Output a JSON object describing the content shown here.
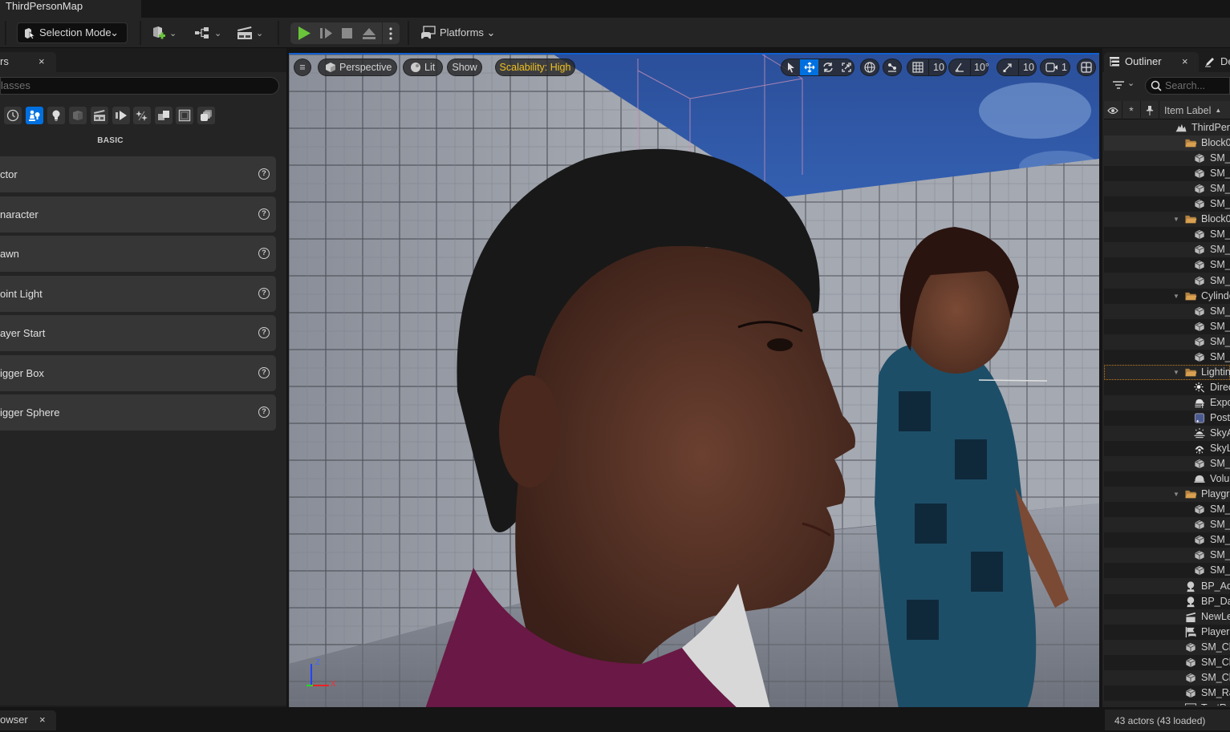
{
  "title_tab": "ThirdPersonMap",
  "toolbar": {
    "selection_mode": "Selection Mode",
    "platforms": "Platforms",
    "icons": [
      "selection-mode-icon",
      "add-actor-icon",
      "blueprint-icon",
      "cinematics-icon",
      "play-icon",
      "step-icon",
      "stop-icon",
      "eject-icon",
      "more-options-icon",
      "platforms-icon"
    ]
  },
  "left_panel": {
    "tab_label": "rs",
    "tab_close": "×",
    "search_placeholder": "lasses",
    "categories": [
      "recent",
      "basic",
      "lights",
      "shapes",
      "cinematic",
      "visual-effects",
      "volumes",
      "all-classes",
      "geometry",
      "others"
    ],
    "active_category": "basic",
    "section_label": "BASIC",
    "items": [
      {
        "label": "ctor"
      },
      {
        "label": "naracter"
      },
      {
        "label": "awn"
      },
      {
        "label": "oint Light"
      },
      {
        "label": "ayer Start"
      },
      {
        "label": "igger Box"
      },
      {
        "label": "igger Sphere"
      }
    ],
    "help_glyph": "?"
  },
  "viewport": {
    "menu_glyph": "≡",
    "perspective": "Perspective",
    "lit": "Lit",
    "show": "Show",
    "scalability": "Scalability: High",
    "grid_snap": "10",
    "rotation_snap": "10°",
    "scale_snap": "10",
    "camera_speed": "1",
    "axis_x": "X",
    "axis_z": "Z",
    "accent": "#0070e0",
    "scalability_color": "#f0c020"
  },
  "outliner": {
    "tab_label": "Outliner",
    "tab_close": "×",
    "details_tab": "De",
    "search_placeholder": "Search...",
    "column_label": "Item Label",
    "sort_glyph": "▲",
    "rows": [
      {
        "label": "ThirdPer",
        "icon": "world",
        "indent": 0,
        "arrow": ""
      },
      {
        "label": "Block0",
        "icon": "folder",
        "indent": 1,
        "arrow": ""
      },
      {
        "label": "SM_",
        "icon": "mesh",
        "indent": 2,
        "arrow": ""
      },
      {
        "label": "SM_",
        "icon": "mesh",
        "indent": 2,
        "arrow": ""
      },
      {
        "label": "SM_",
        "icon": "mesh",
        "indent": 2,
        "arrow": ""
      },
      {
        "label": "SM_",
        "icon": "mesh",
        "indent": 2,
        "arrow": ""
      },
      {
        "label": "Block0",
        "icon": "folder",
        "indent": 1,
        "arrow": "▼"
      },
      {
        "label": "SM_",
        "icon": "mesh",
        "indent": 2,
        "arrow": ""
      },
      {
        "label": "SM_",
        "icon": "mesh",
        "indent": 2,
        "arrow": ""
      },
      {
        "label": "SM_",
        "icon": "mesh",
        "indent": 2,
        "arrow": ""
      },
      {
        "label": "SM_",
        "icon": "mesh",
        "indent": 2,
        "arrow": ""
      },
      {
        "label": "Cylinde",
        "icon": "folder",
        "indent": 1,
        "arrow": "▼"
      },
      {
        "label": "SM_",
        "icon": "mesh",
        "indent": 2,
        "arrow": ""
      },
      {
        "label": "SM_",
        "icon": "mesh",
        "indent": 2,
        "arrow": ""
      },
      {
        "label": "SM_",
        "icon": "mesh",
        "indent": 2,
        "arrow": ""
      },
      {
        "label": "SM_",
        "icon": "mesh",
        "indent": 2,
        "arrow": ""
      },
      {
        "label": "Lightin",
        "icon": "folder",
        "indent": 1,
        "arrow": "▼"
      },
      {
        "label": "Direc",
        "icon": "directional-light",
        "indent": 2,
        "arrow": ""
      },
      {
        "label": "Expo",
        "icon": "exponential-fog",
        "indent": 2,
        "arrow": ""
      },
      {
        "label": "Post",
        "icon": "post-process",
        "indent": 2,
        "arrow": ""
      },
      {
        "label": "SkyA",
        "icon": "sky-atmosphere",
        "indent": 2,
        "arrow": ""
      },
      {
        "label": "SkyL",
        "icon": "sky-light",
        "indent": 2,
        "arrow": ""
      },
      {
        "label": "SM_",
        "icon": "mesh",
        "indent": 2,
        "arrow": ""
      },
      {
        "label": "Volu",
        "icon": "volumetric-cloud",
        "indent": 2,
        "arrow": ""
      },
      {
        "label": "Playgr",
        "icon": "folder",
        "indent": 1,
        "arrow": "▼"
      },
      {
        "label": "SM_",
        "icon": "mesh",
        "indent": 2,
        "arrow": ""
      },
      {
        "label": "SM_",
        "icon": "mesh",
        "indent": 2,
        "arrow": ""
      },
      {
        "label": "SM_",
        "icon": "mesh",
        "indent": 2,
        "arrow": ""
      },
      {
        "label": "SM_",
        "icon": "mesh",
        "indent": 2,
        "arrow": ""
      },
      {
        "label": "SM_",
        "icon": "mesh",
        "indent": 2,
        "arrow": ""
      },
      {
        "label": "BP_Ad",
        "icon": "blueprint-actor",
        "indent": 0,
        "arrow": ""
      },
      {
        "label": "BP_Da",
        "icon": "blueprint-actor",
        "indent": 0,
        "arrow": ""
      },
      {
        "label": "NewLe",
        "icon": "level-sequence",
        "indent": 0,
        "arrow": ""
      },
      {
        "label": "Player",
        "icon": "player-start",
        "indent": 0,
        "arrow": ""
      },
      {
        "label": "SM_Ch",
        "icon": "mesh",
        "indent": 0,
        "arrow": ""
      },
      {
        "label": "SM_Ch",
        "icon": "mesh",
        "indent": 0,
        "arrow": ""
      },
      {
        "label": "SM_Ch",
        "icon": "mesh",
        "indent": 0,
        "arrow": ""
      },
      {
        "label": "SM_Ra",
        "icon": "mesh",
        "indent": 0,
        "arrow": ""
      },
      {
        "label": "TextRe",
        "icon": "text-render",
        "indent": 0,
        "arrow": ""
      }
    ],
    "status": "43 actors (43 loaded)"
  },
  "bottom": {
    "content_browser_tab": "owser",
    "tab_close": "×"
  }
}
